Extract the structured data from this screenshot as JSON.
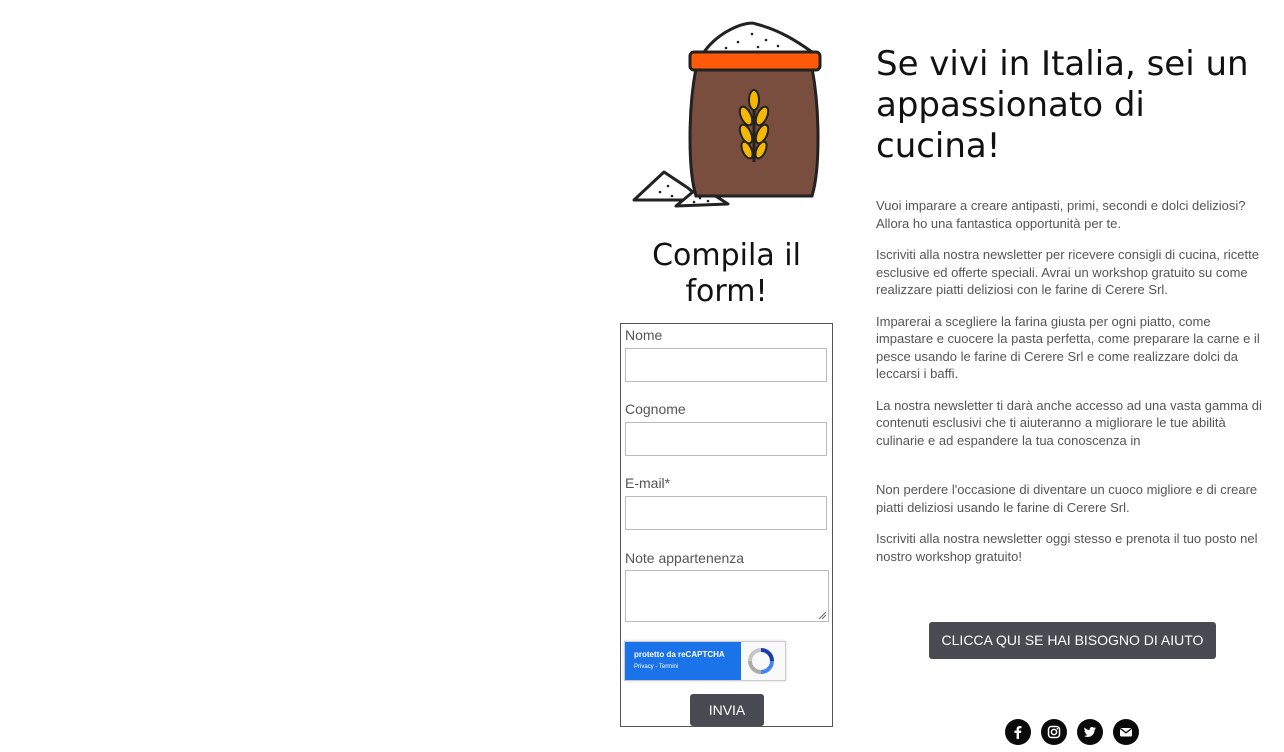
{
  "form": {
    "title": "Compila il form!",
    "fields": [
      {
        "label": "Nome",
        "value": ""
      },
      {
        "label": "Cognome",
        "value": ""
      },
      {
        "label": "E-mail*",
        "value": ""
      },
      {
        "label": "Note appartenenza",
        "value": ""
      }
    ],
    "recaptcha": {
      "line1": "protetto da reCAPTCHA",
      "line2": "Privacy - Termini"
    },
    "submit_label": "INVIA"
  },
  "content": {
    "headline": "Se vivi in Italia, sei un appassionato di cucina!",
    "paragraphs": [
      "Vuoi imparare a creare antipasti, primi, secondi e dolci deliziosi?Allora ho una fantastica opportunità per te.",
      "Iscriviti alla nostra newsletter per ricevere consigli di cucina, ricette esclusive ed offerte speciali. Avrai un workshop gratuito su come realizzare piatti deliziosi con le farine di Cerere Srl.",
      "Imparerai a scegliere la farina giusta per ogni piatto, come impastare e cuocere la pasta perfetta, come preparare la carne e il pesce usando le farine di Cerere Srl e come realizzare dolci da leccarsi i baffi.",
      "La nostra newsletter ti darà anche accesso ad una vasta gamma di contenuti esclusivi che ti aiuteranno a migliorare le tue abilità culinarie e ad espandere la tua conoscenza in",
      "Non perdere l'occasione di diventare un cuoco migliore e di creare piatti deliziosi usando le farine di Cerere Srl.",
      "Iscriviti alla nostra newsletter oggi stesso e prenota il tuo posto nel nostro workshop gratuito!"
    ],
    "help_button_label": "CLICCA QUI SE HAI BISOGNO DI AIUTO"
  },
  "social": [
    "facebook-icon",
    "instagram-icon",
    "twitter-icon",
    "email-icon"
  ],
  "colors": {
    "button_bg": "#4a4a52",
    "sack_body": "#7a4e3e",
    "sack_band": "#ff5a0a",
    "wheat": "#f5b800",
    "recaptcha_blue": "#1a73e8"
  }
}
